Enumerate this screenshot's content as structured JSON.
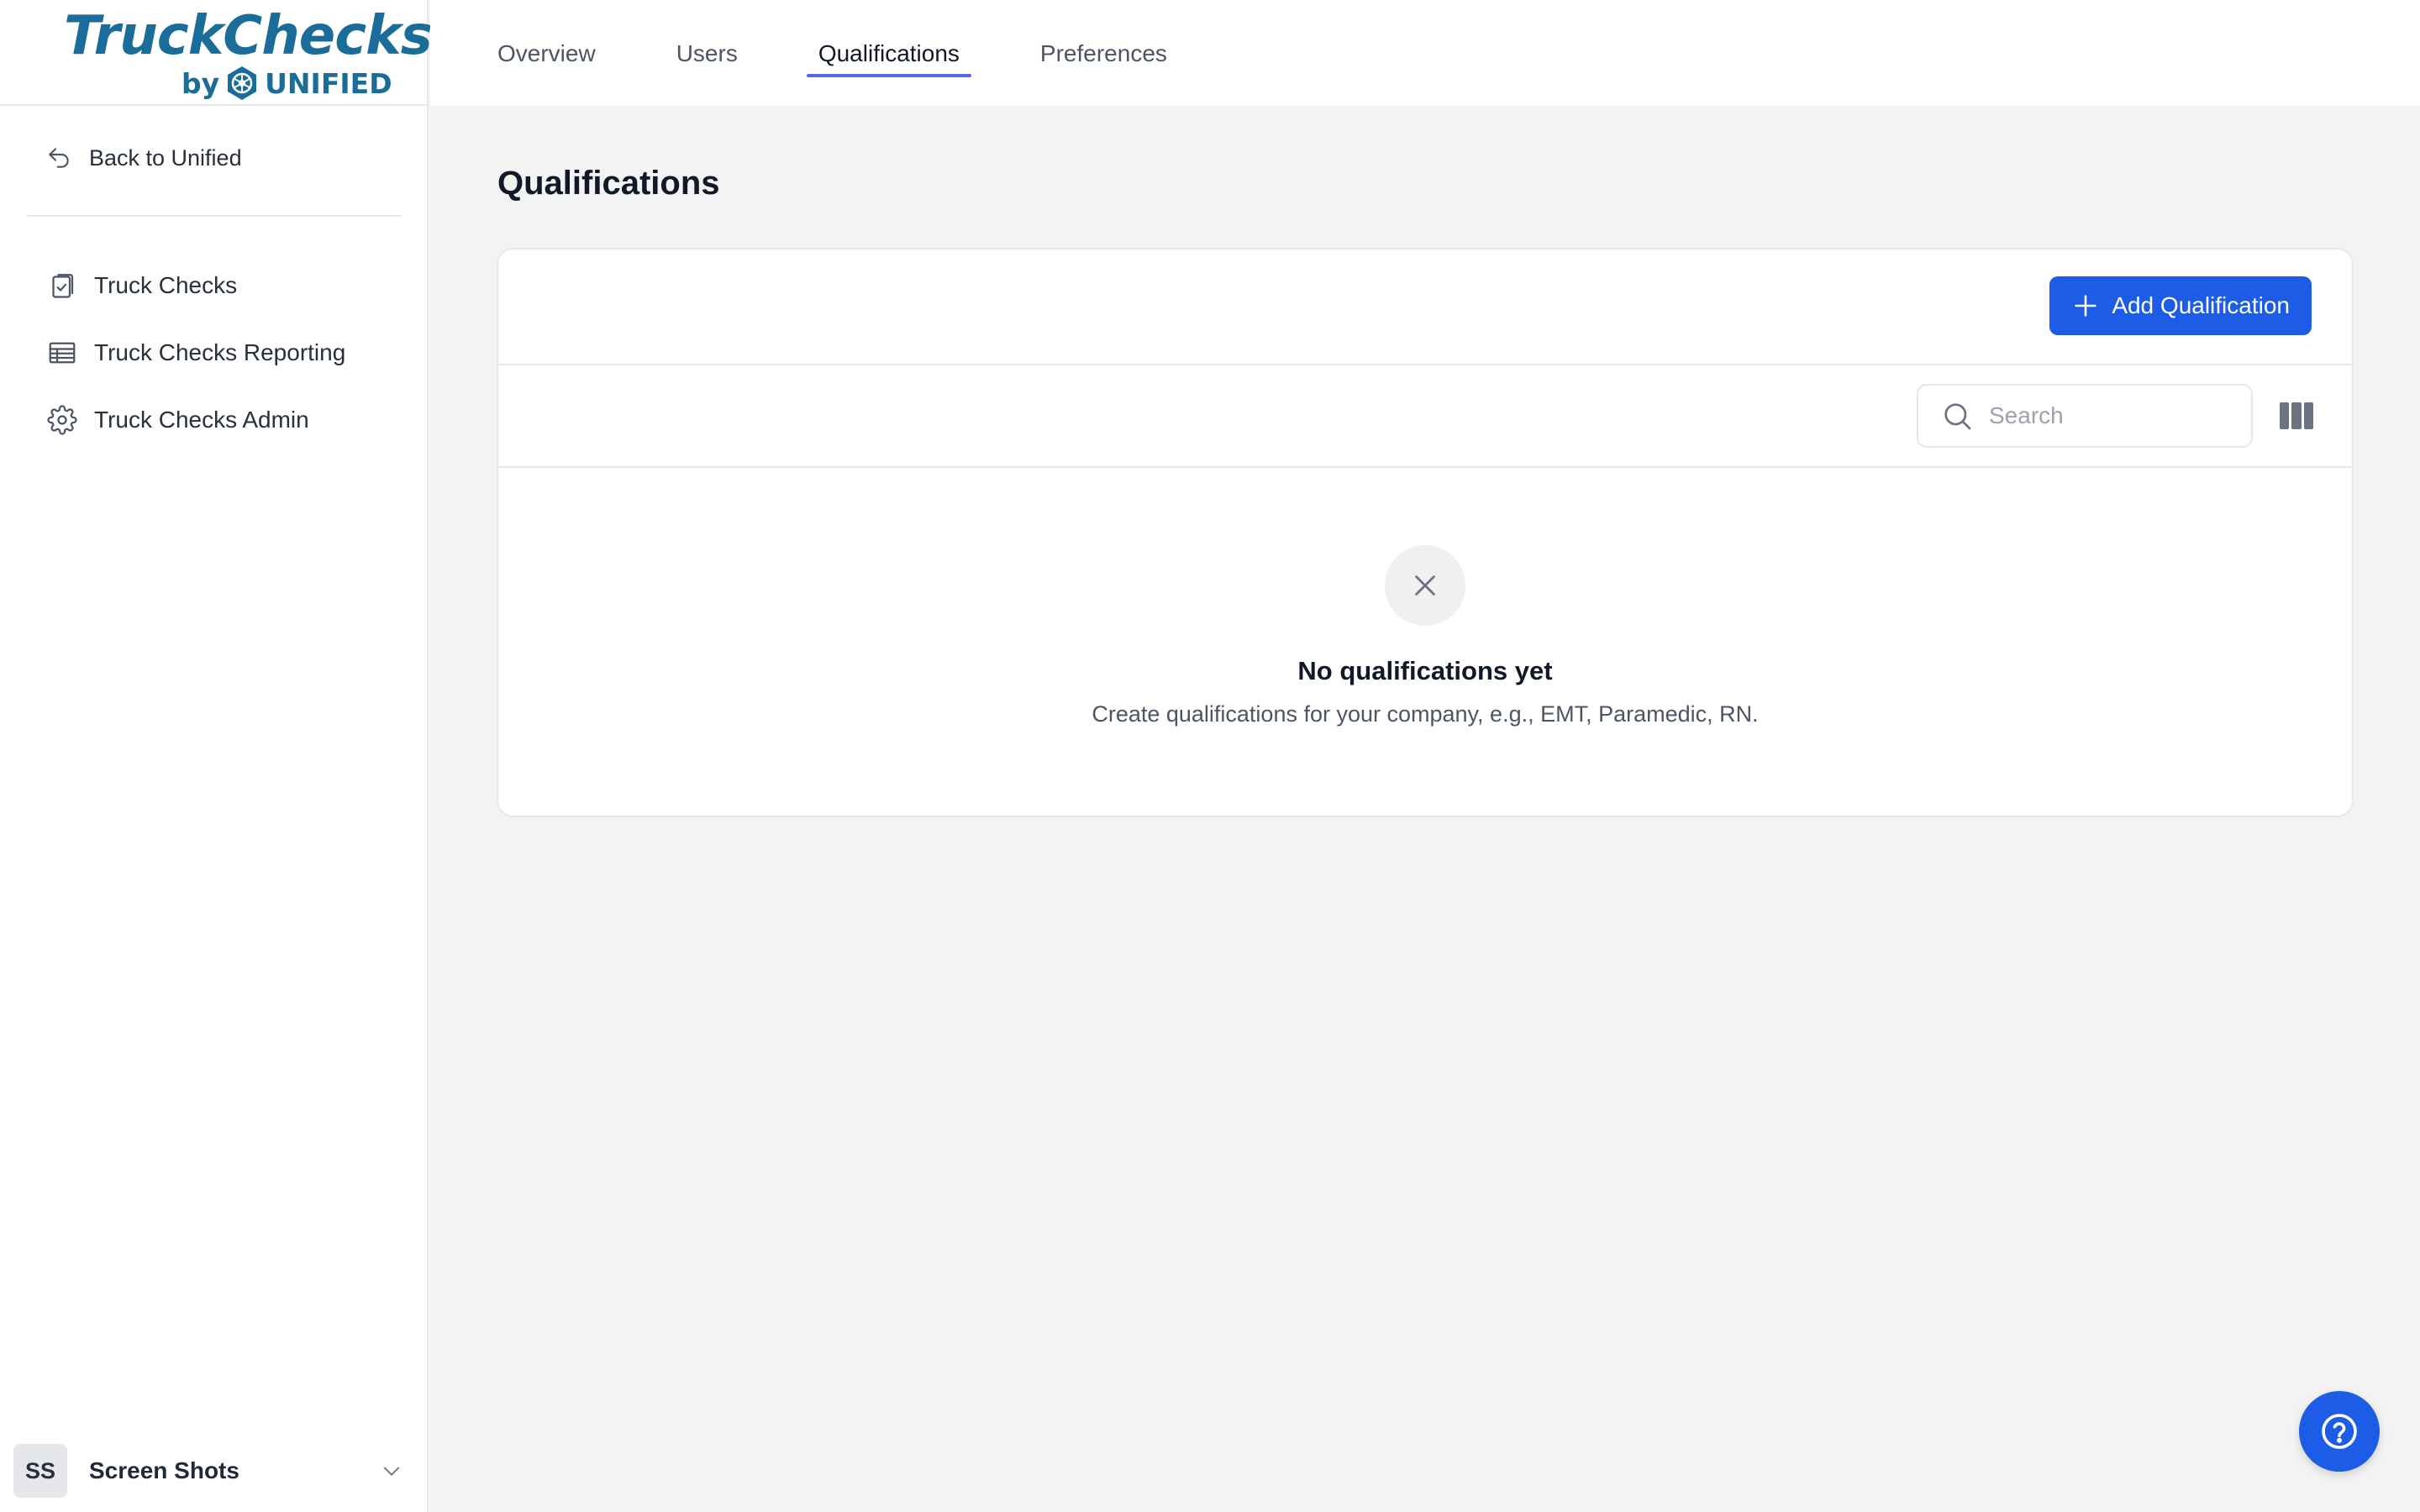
{
  "brand": {
    "logo_main": "TruckChecks",
    "logo_by": "by",
    "logo_company": "UNIFIED",
    "color": "#1b6d99"
  },
  "sidebar": {
    "back_label": "Back to Unified",
    "items": [
      {
        "label": "Truck Checks",
        "icon": "clipboard-check-icon"
      },
      {
        "label": "Truck Checks Reporting",
        "icon": "table-icon"
      },
      {
        "label": "Truck Checks Admin",
        "icon": "gear-icon"
      }
    ],
    "user": {
      "initials": "SS",
      "name": "Screen Shots"
    }
  },
  "tabs": [
    {
      "label": "Overview",
      "active": false
    },
    {
      "label": "Users",
      "active": false
    },
    {
      "label": "Qualifications",
      "active": true
    },
    {
      "label": "Preferences",
      "active": false
    }
  ],
  "main": {
    "title": "Qualifications",
    "add_button_label": "Add Qualification",
    "search_placeholder": "Search",
    "empty_title": "No qualifications yet",
    "empty_description": "Create qualifications for your company, e.g., EMT, Paramedic, RN."
  },
  "colors": {
    "accent": "#1d5ce6",
    "tab_underline": "#5b66e8",
    "background": "#f3f3f3"
  }
}
